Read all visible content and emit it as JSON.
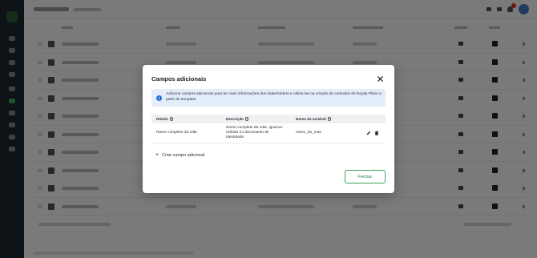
{
  "modal": {
    "title": "Campos adicionais",
    "info_text": "Adicione campos adicionais para ter mais informações dos stakeholders e utilizá-las na criação de contratos de Equity Plans a partir de template.",
    "columns": [
      "Rótulo",
      "Descrição",
      "Nome da variável"
    ],
    "rows": [
      {
        "label": "Nome completo da mãe",
        "description": "Nome completo da mãe, igual ao exibido no documento de identidade",
        "variable": "nome_da_mae"
      }
    ],
    "add_field_label": "Criar campo adicional",
    "close_label": "Fechar"
  },
  "icons": {
    "close": "close-icon",
    "info": "info-icon",
    "help": "help-icon",
    "edit": "pencil-icon",
    "delete": "trash-icon",
    "add": "plus-icon"
  },
  "colors": {
    "accent": "#3aa55a",
    "info_bg": "#e4eefa",
    "info_icon": "#1f6fd1",
    "overlay": "rgba(0,0,0,0.52)"
  }
}
